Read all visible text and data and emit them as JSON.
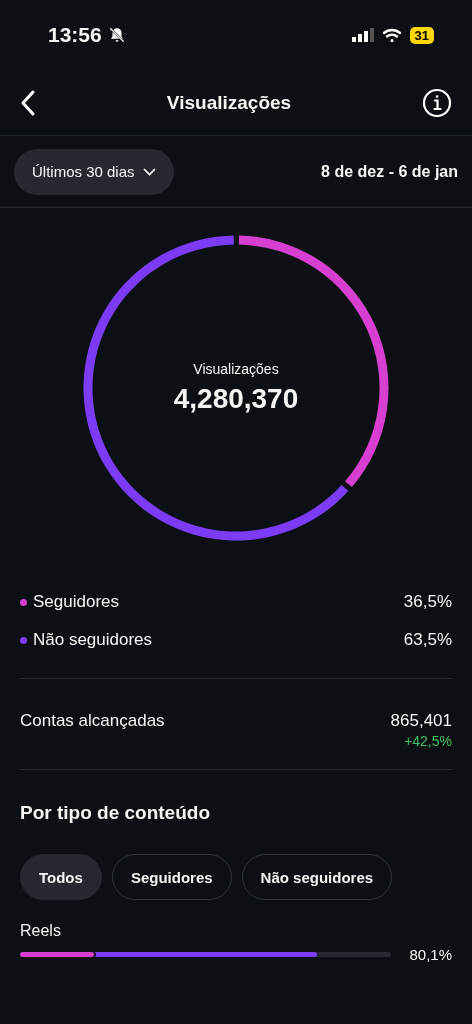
{
  "status_bar": {
    "time": "13:56",
    "battery": "31"
  },
  "header": {
    "title": "Visualizações"
  },
  "filter": {
    "range": "Últimos 30 dias",
    "dates": "8 de dez - 6 de jan"
  },
  "summary": {
    "label": "Visualizações",
    "total": "4,280,370",
    "chart_data": {
      "type": "donut",
      "categories": [
        "Seguidores",
        "Não seguidores"
      ],
      "values": [
        36.5,
        63.5
      ]
    }
  },
  "legend": [
    {
      "value": "36,5%",
      "color": "#d63fd0"
    },
    {
      "value": "63,5%",
      "color": "#7c3cf5"
    }
  ],
  "reach": {
    "label": "Contas alcançadas",
    "value": "865,401",
    "change": "+42,5%"
  },
  "content_type": {
    "title": "Por tipo de conteúdo",
    "chips": [
      {
        "label": "Todos",
        "selected": true
      },
      {
        "label": "Seguidores",
        "selected": false
      },
      {
        "label": "Não seguidores",
        "selected": false
      }
    ],
    "rows": [
      {
        "label": "Reels",
        "value": "80,1%",
        "fills": [
          {
            "level": 0.8,
            "color": "#7c3cf5"
          },
          {
            "level": 0.2,
            "color": "#d63fd0"
          }
        ]
      }
    ]
  }
}
